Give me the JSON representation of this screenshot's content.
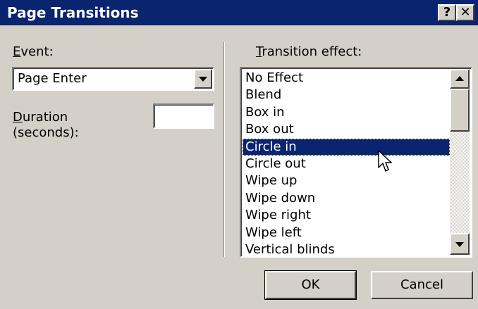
{
  "dialog": {
    "title": "Page Transitions",
    "help_button": "?",
    "close_button": "✕"
  },
  "event": {
    "label_accel": "E",
    "label_rest": "vent:",
    "selected": "Page Enter"
  },
  "duration": {
    "label_accel": "D",
    "label_line1_rest": "uration",
    "label_line2": "(seconds):",
    "value": ""
  },
  "transition": {
    "label_accel": "T",
    "label_rest": "ransition effect:",
    "items": [
      "No Effect",
      "Blend",
      "Box in",
      "Box out",
      "Circle in",
      "Circle out",
      "Wipe up",
      "Wipe down",
      "Wipe right",
      "Wipe left",
      "Vertical blinds"
    ],
    "selected": "Circle in"
  },
  "buttons": {
    "ok": "OK",
    "cancel": "Cancel"
  },
  "colors": {
    "titlebar": "#0a2470",
    "face": "#d4d0c8",
    "selection": "#0a2470"
  }
}
